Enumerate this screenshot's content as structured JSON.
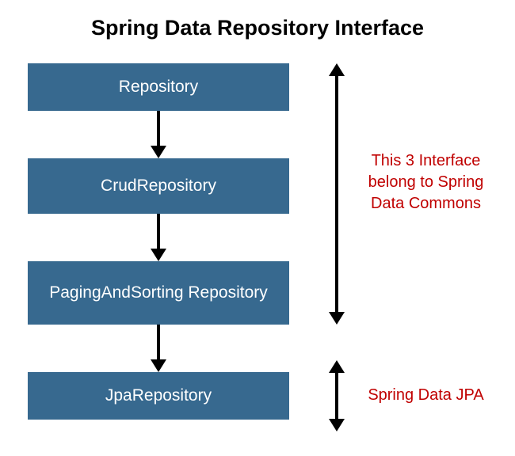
{
  "title": "Spring Data Repository Interface",
  "boxes": {
    "b1": "Repository",
    "b2": "CrudRepository",
    "b3": "PagingAndSorting Repository",
    "b4": "JpaRepository"
  },
  "annotations": {
    "a1": "This 3 Interface belong to Spring Data Commons",
    "a2": "Spring Data JPA"
  },
  "colors": {
    "box_bg": "#37698f",
    "box_text": "#ffffff",
    "annotation_text": "#c00000"
  }
}
